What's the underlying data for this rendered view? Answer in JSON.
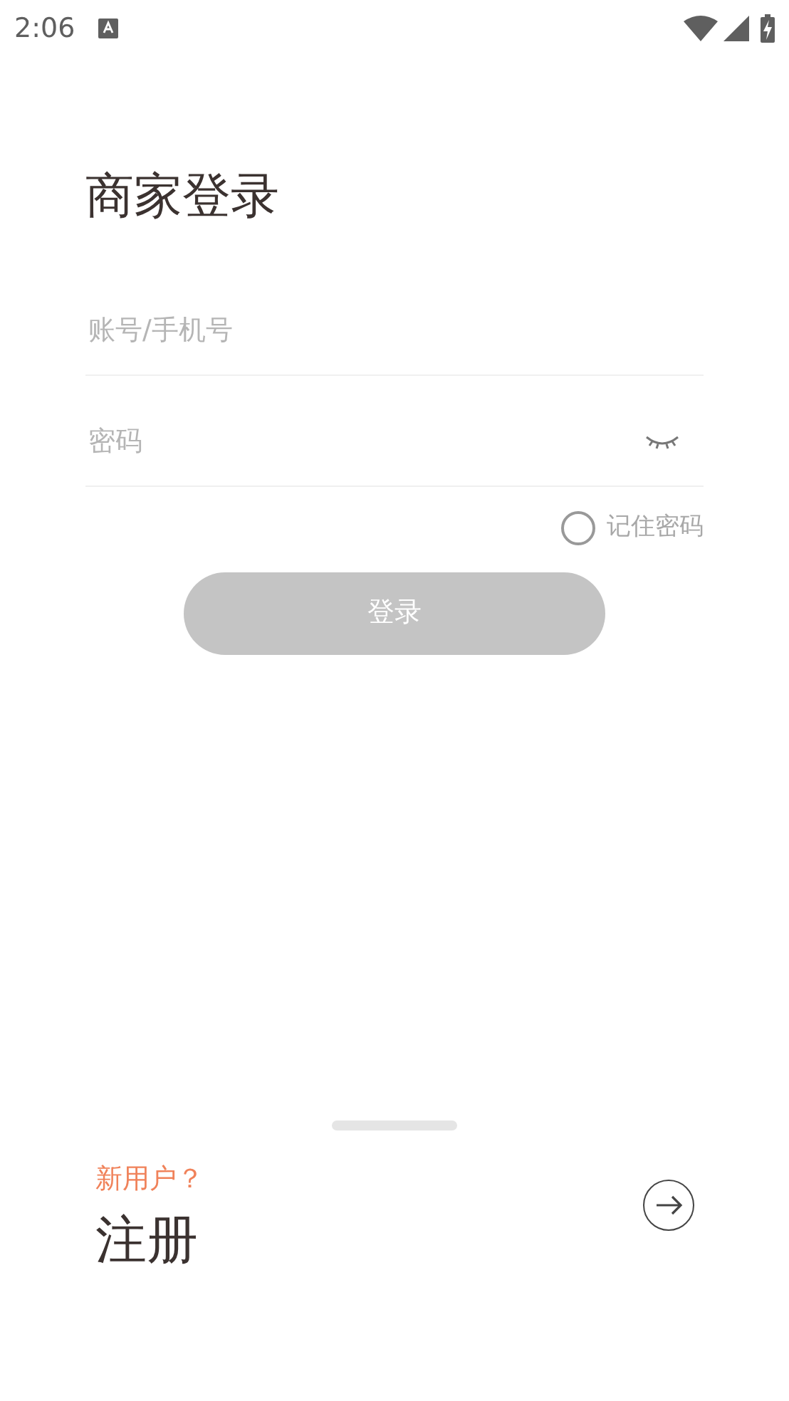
{
  "status_bar": {
    "time": "2:06"
  },
  "title": "商家登录",
  "account_field": {
    "placeholder": "账号/手机号"
  },
  "password_field": {
    "placeholder": "密码",
    "visible": false
  },
  "remember": {
    "label": "记住密码",
    "checked": false
  },
  "login_button": {
    "label": "登录",
    "disabled": true
  },
  "register": {
    "prompt": "新用户？",
    "label": "注册"
  }
}
